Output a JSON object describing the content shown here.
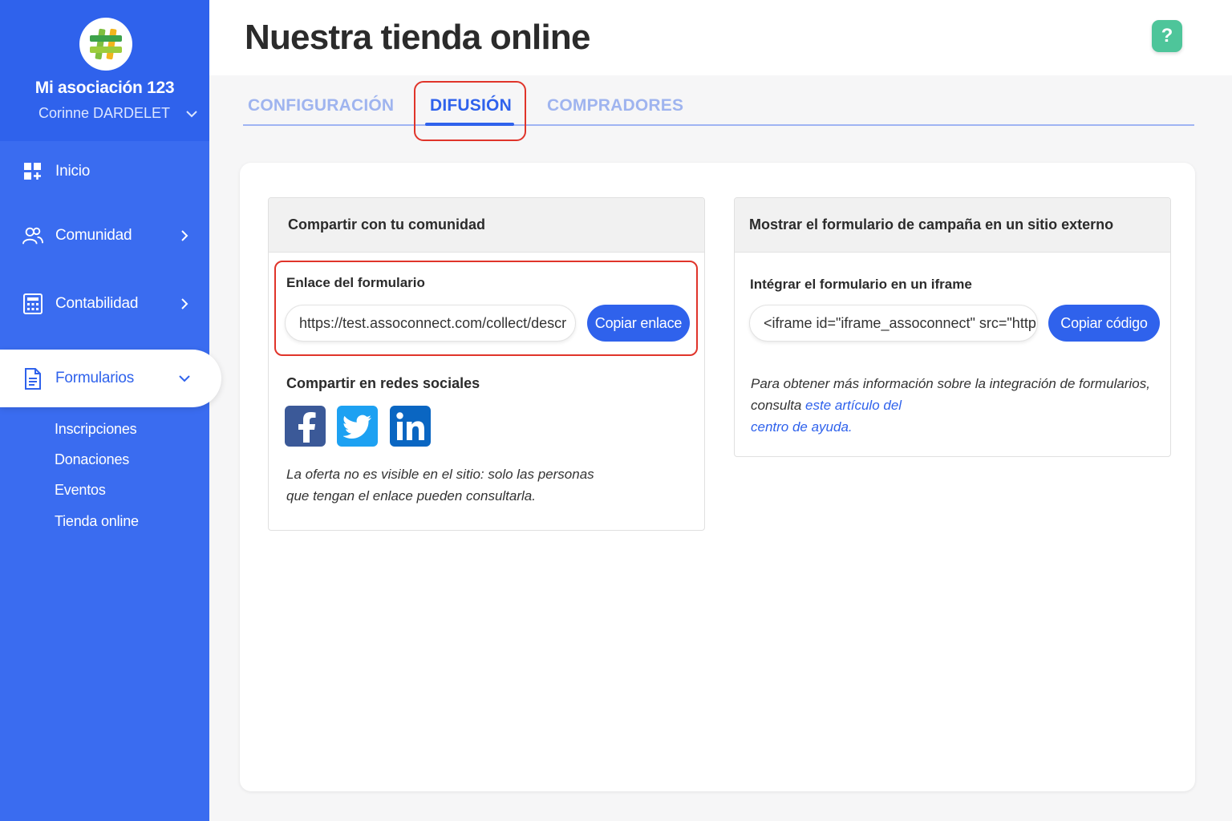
{
  "sidebar": {
    "org_name": "Mi asociación 123",
    "user_name": "Corinne DARDELET",
    "nav": {
      "inicio": "Inicio",
      "comunidad": "Comunidad",
      "contabilidad": "Contabilidad",
      "formularios": "Formularios"
    },
    "sub_items": [
      "Inscripciones",
      "Donaciones",
      "Eventos",
      "Tienda online"
    ]
  },
  "header": {
    "title": "Nuestra tienda online",
    "help_label": "?"
  },
  "tabs": [
    "CONFIGURACIÓN",
    "DIFUSIÓN",
    "COMPRADORES"
  ],
  "active_tab": "DIFUSIÓN",
  "share_panel": {
    "title": "Compartir con tu comunidad",
    "link_label": "Enlace del formulario",
    "link_value": "https://test.assoconnect.com/collect/descr",
    "copy_link_button": "Copiar enlace",
    "social_title": "Compartir en redes sociales",
    "social_networks": [
      "facebook-icon",
      "twitter-icon",
      "linkedin-icon"
    ],
    "note_line1": "La oferta no es visible en el sitio: solo las personas",
    "note_line2": "que tengan el enlace pueden consultarla."
  },
  "embed_panel": {
    "title": "Mostrar el formulario de campaña en un sitio externo",
    "iframe_label": "Intégrar el formulario en un iframe",
    "iframe_value": "<iframe id=\"iframe_assoconnect\" src=\"http",
    "copy_code_button": "Copiar código",
    "info_line1": "Para obtener más información sobre la integración de formularios,",
    "info_line2_prefix": "consulta ",
    "info_link_part1": "este artículo del",
    "info_link_part2": "centro de ayuda."
  },
  "colors": {
    "primary": "#2f62ec",
    "sidebar": "#3a6cf0",
    "highlight": "#e0342a",
    "help": "#4ec59a",
    "facebook": "#3b5998",
    "twitter": "#1da1f2",
    "linkedin": "#0a66c2"
  }
}
